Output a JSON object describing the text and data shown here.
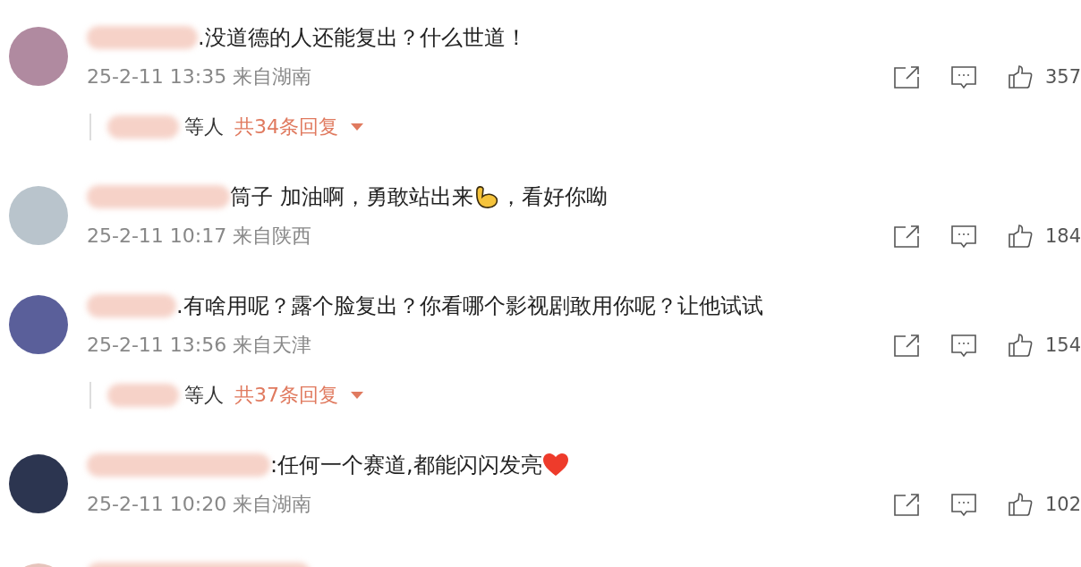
{
  "comments": [
    {
      "kind": "full",
      "segments": [
        {
          "kind": "text",
          "text": ".没道德的人还能复出？什么世道！"
        }
      ],
      "date": "25-2-11 13:35",
      "location": "来自湖南",
      "likes": "357",
      "replies": {
        "suffix": "等人",
        "count": "共34条回复"
      }
    },
    {
      "kind": "full",
      "segments": [
        {
          "kind": "text",
          "text": "筒子 加油啊，勇敢站出来"
        },
        {
          "kind": "arm"
        },
        {
          "kind": "text",
          "text": "，看好你呦"
        }
      ],
      "date": "25-2-11 10:17",
      "location": "来自陕西",
      "likes": "184"
    },
    {
      "kind": "full",
      "segments": [
        {
          "kind": "text",
          "text": ".有啥用呢？露个脸复出？你看哪个影视剧敢用你呢？让他试试"
        }
      ],
      "date": "25-2-11 13:56",
      "location": "来自天津",
      "likes": "154",
      "replies": {
        "suffix": "等人",
        "count": "共37条回复"
      }
    },
    {
      "kind": "full",
      "segments": [
        {
          "kind": "text",
          "text": ":任何一个赛道,都能闪闪发亮"
        },
        {
          "kind": "heart"
        }
      ],
      "date": "25-2-11 10:20",
      "location": "来自湖南",
      "likes": "102"
    },
    {
      "kind": "cut"
    }
  ]
}
